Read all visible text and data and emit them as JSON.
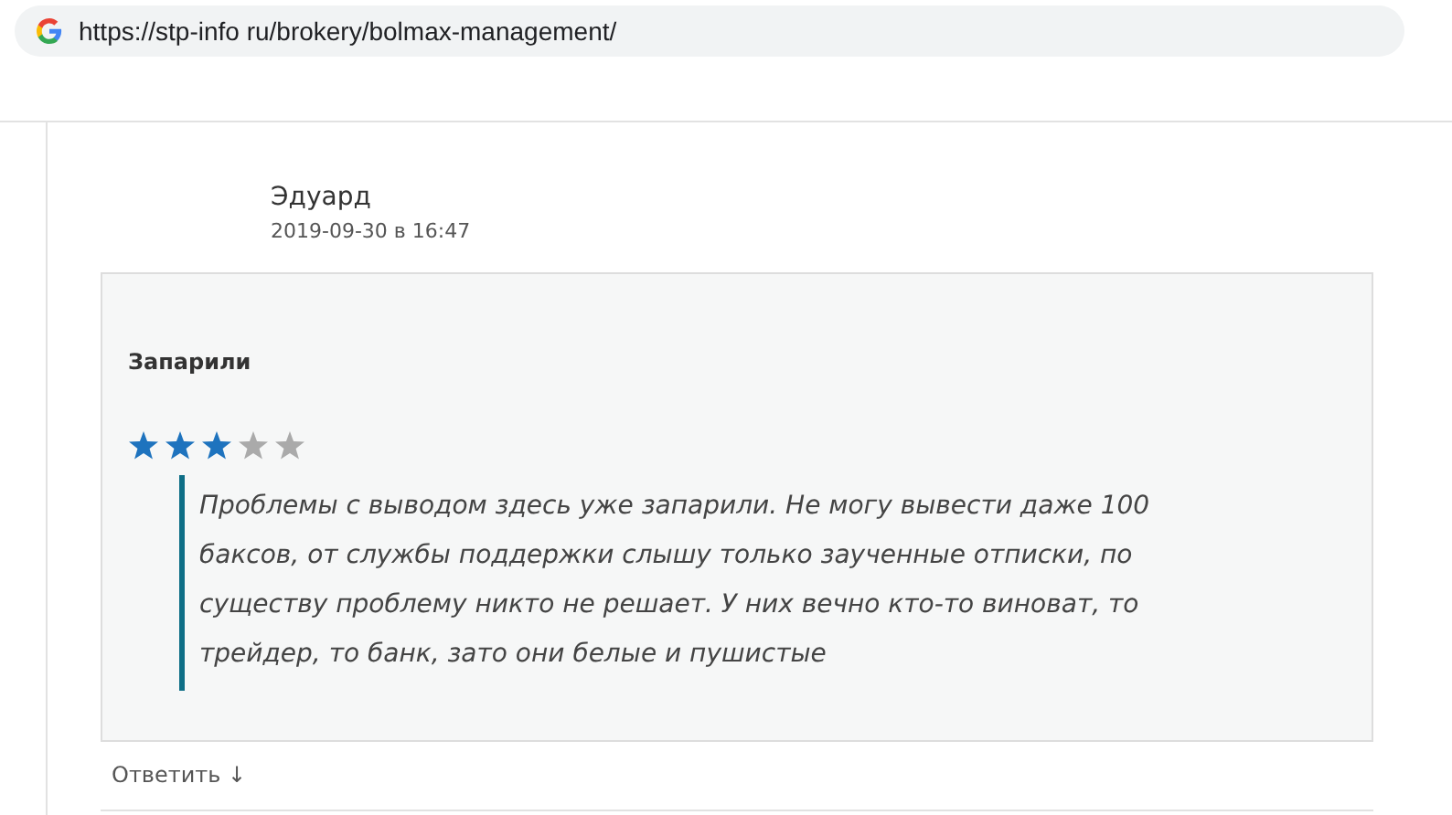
{
  "address_bar": {
    "url": "https://stp-info ru/brokery/bolmax-management/"
  },
  "comment": {
    "author": "Эдуард",
    "date": "2019-09-30 в 16:47",
    "title": "Запарили",
    "stars": 3,
    "text": "Проблемы с выводом здесь уже запарили. Не могу вывести даже 100 баксов, от службы поддержки слышу только заученные отписки, по существу проблему никто не решает. У них вечно кто-то виноват, то трейдер, то банк, зато они белые и пушистые",
    "reply": "Ответить ↓"
  }
}
